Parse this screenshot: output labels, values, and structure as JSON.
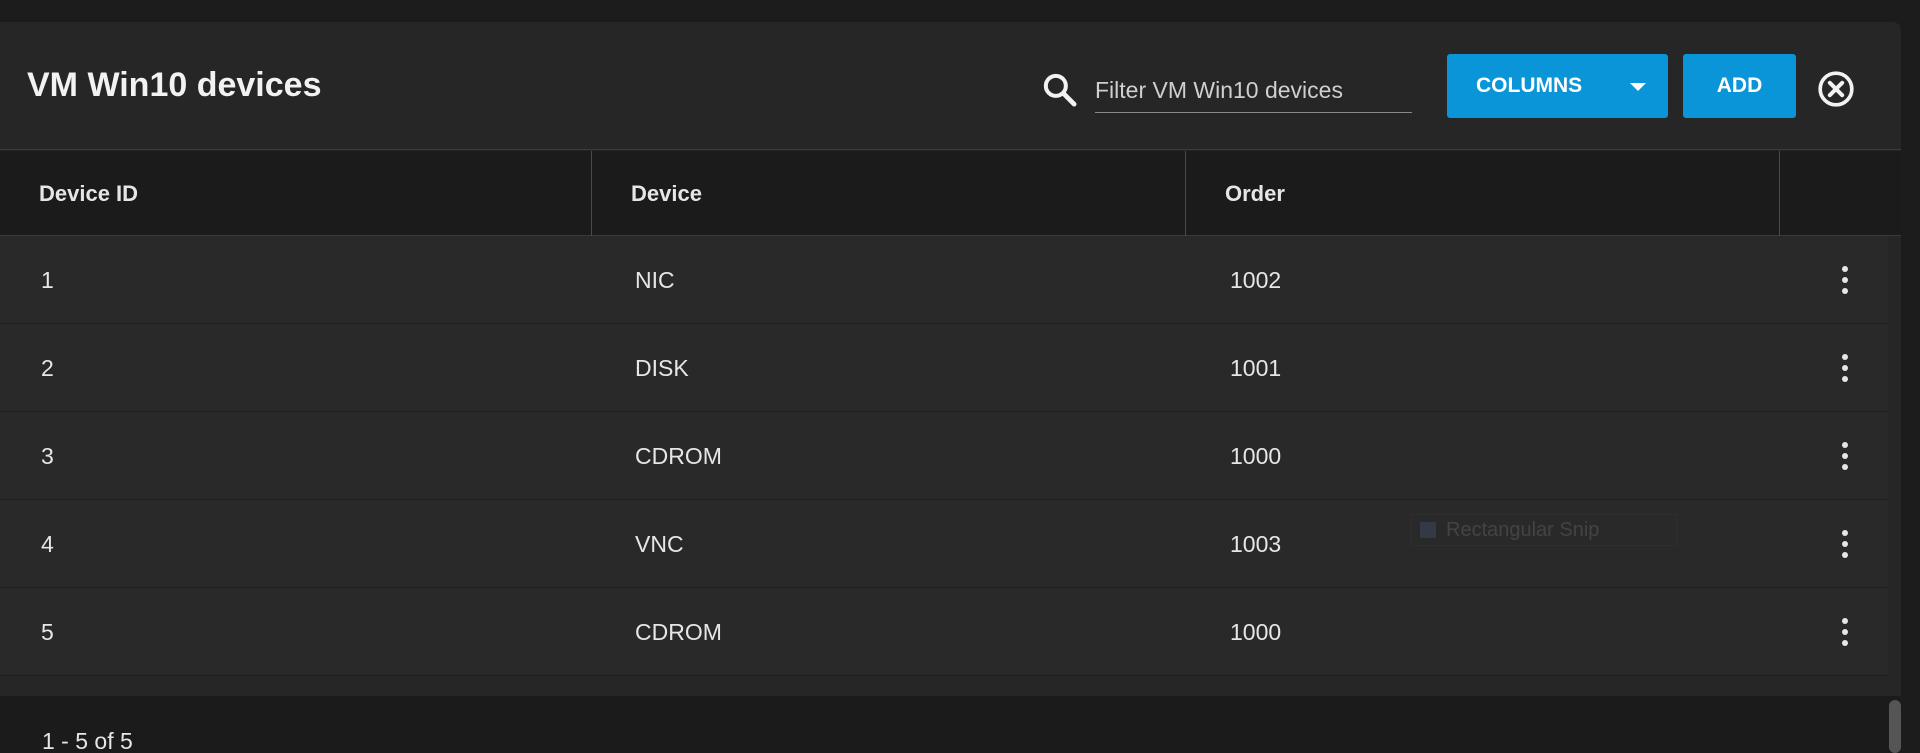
{
  "header": {
    "title": "VM Win10 devices",
    "search_placeholder": "Filter VM Win10 devices",
    "columns_label": "COLUMNS",
    "add_label": "ADD"
  },
  "table": {
    "columns": [
      "Device ID",
      "Device",
      "Order"
    ],
    "rows": [
      {
        "id": "1",
        "device": "NIC",
        "order": "1002"
      },
      {
        "id": "2",
        "device": "DISK",
        "order": "1001"
      },
      {
        "id": "3",
        "device": "CDROM",
        "order": "1000"
      },
      {
        "id": "4",
        "device": "VNC",
        "order": "1003"
      },
      {
        "id": "5",
        "device": "CDROM",
        "order": "1000"
      }
    ]
  },
  "overlay": {
    "label": "Rectangular Snip"
  },
  "footer": {
    "pagination": "1 - 5 of 5"
  },
  "colors": {
    "accent": "#0a95d8",
    "background": "#262626",
    "header_row": "#1b1b1b"
  },
  "icons": {
    "search": "search-icon",
    "close": "close-circle-icon",
    "row_menu": "more-vert-icon",
    "dropdown": "caret-down-icon"
  }
}
